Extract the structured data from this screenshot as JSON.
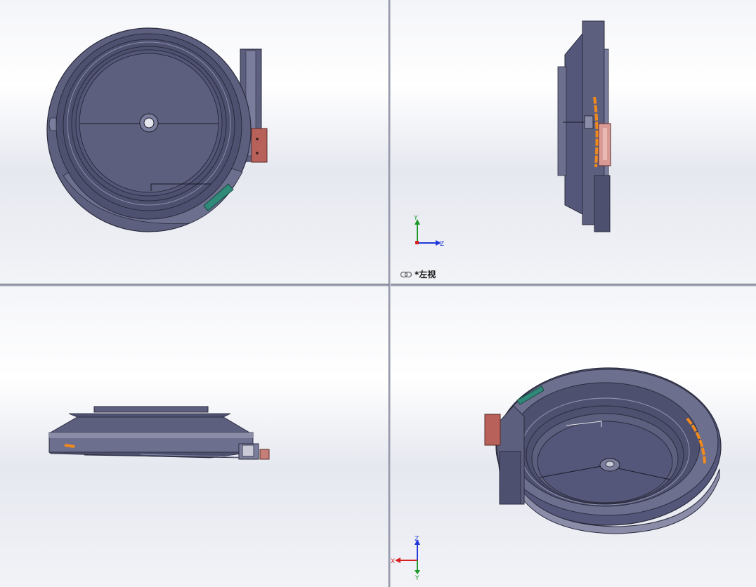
{
  "viewports": {
    "top_left": {
      "kind": "front-view"
    },
    "top_right": {
      "kind": "left-view",
      "label": "*左视"
    },
    "bottom_left": {
      "kind": "top-view"
    },
    "bottom_right": {
      "kind": "isometric-view"
    }
  },
  "axes": {
    "top_right": {
      "up": "Y",
      "right": "Z"
    },
    "bottom_right": {
      "up": "Z",
      "left": "X",
      "down": "Y"
    }
  },
  "colors": {
    "bowl_body": "#5d5f7e",
    "bowl_dark": "#3d3f58",
    "bowl_light": "#8a8ca8",
    "copper_part": "#b8615a",
    "teal_part": "#2f8a7a",
    "orange_accent": "#f08a1c",
    "axis_y": "#1f9a2a",
    "axis_z": "#2238d8",
    "axis_x": "#d42222"
  }
}
